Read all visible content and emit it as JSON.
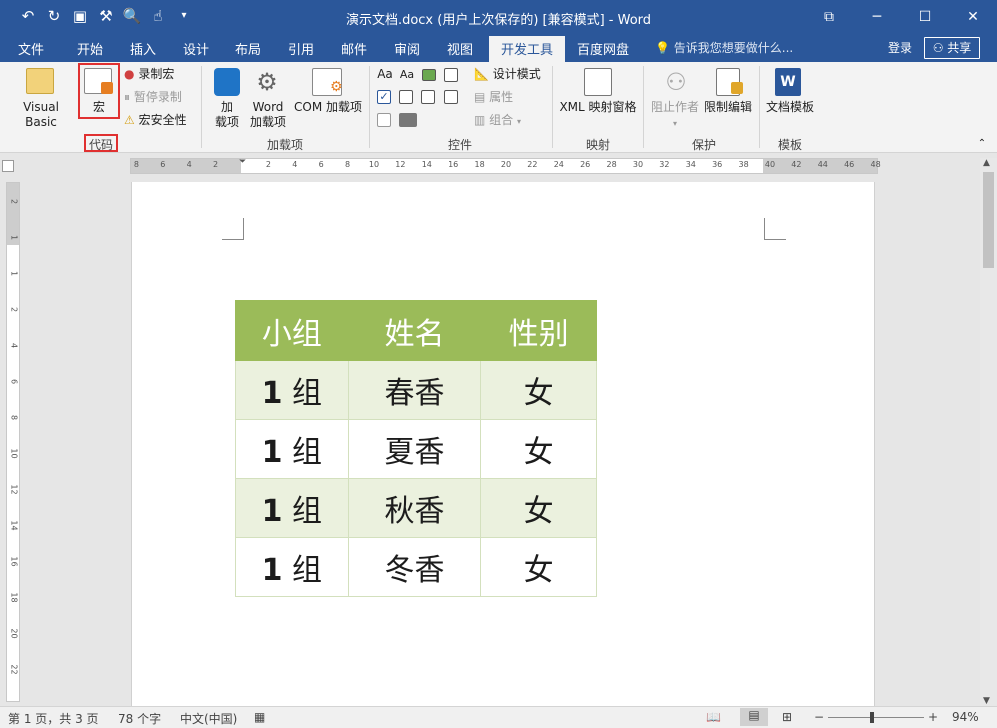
{
  "titlebar": {
    "title": "演示文档.docx (用户上次保存的) [兼容模式] - Word",
    "qat": [
      "undo-icon",
      "redo-icon",
      "save-icon",
      "format-painter-icon",
      "print-preview-icon",
      "touch-mode-icon",
      "customize-icon"
    ],
    "window_controls": [
      "ribbon-display-icon",
      "minimize-icon",
      "maximize-icon",
      "close-icon"
    ]
  },
  "tabs": [
    "文件",
    "开始",
    "插入",
    "设计",
    "布局",
    "引用",
    "邮件",
    "审阅",
    "视图",
    "开发工具",
    "百度网盘"
  ],
  "active_tab": "开发工具",
  "tellme": "告诉我您想要做什么...",
  "login": "登录",
  "share": "共享",
  "ribbon": {
    "code": {
      "label": "代码",
      "visual_basic": "Visual Basic",
      "macro": "宏",
      "record": "录制宏",
      "pause": "暂停录制",
      "security": "宏安全性"
    },
    "addins": {
      "label": "加载项",
      "addin_line1": "加",
      "addin_line2": "载项",
      "word_line1": "Word",
      "word_line2": "加载项",
      "com": "COM 加载项"
    },
    "controls": {
      "label": "控件",
      "design_mode": "设计模式",
      "properties": "属性",
      "group": "组合"
    },
    "mapping": {
      "label": "映射",
      "xml": "XML 映射窗格"
    },
    "protect": {
      "label": "保护",
      "block": "阻止作者",
      "restrict": "限制编辑"
    },
    "templates": {
      "label": "模板",
      "doc_template": "文档模板"
    }
  },
  "ruler": {
    "ticks_left": [
      "8",
      "6",
      "4",
      "2"
    ],
    "ticks_right": [
      "2",
      "4",
      "6",
      "8",
      "10",
      "12",
      "14",
      "16",
      "18",
      "20",
      "22",
      "24",
      "26",
      "28",
      "30",
      "32",
      "34",
      "36",
      "38",
      "40",
      "42",
      "44",
      "46",
      "48"
    ],
    "vticks": [
      "2",
      "1",
      "1",
      "2",
      "4",
      "6",
      "8",
      "10",
      "12",
      "14",
      "16",
      "18",
      "20",
      "22"
    ]
  },
  "table": {
    "header": [
      "小组",
      "姓名",
      "性别"
    ],
    "rows": [
      {
        "num": "1",
        "unit": "组",
        "name": "春香",
        "gender": "女"
      },
      {
        "num": "1",
        "unit": "组",
        "name": "夏香",
        "gender": "女"
      },
      {
        "num": "1",
        "unit": "组",
        "name": "秋香",
        "gender": "女"
      },
      {
        "num": "1",
        "unit": "组",
        "name": "冬香",
        "gender": "女"
      }
    ]
  },
  "statusbar": {
    "page": "第 1 页，共 3 页",
    "words": "78 个字",
    "language": "中文(中国)",
    "zoom": "94%"
  },
  "colors": {
    "brand": "#2b579a",
    "table_header": "#9bbb59",
    "table_band": "#ebf1de",
    "highlight": "#e03030"
  }
}
